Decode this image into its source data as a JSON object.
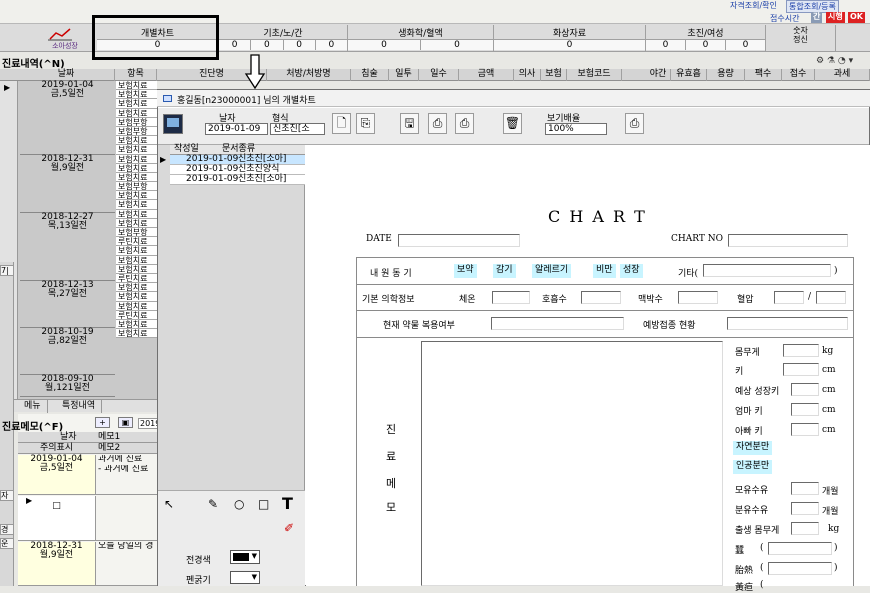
{
  "top_links": {
    "link1": "자격조회/확인",
    "link2": "통합조회/등록",
    "time_label": "접수시간",
    "tag_grey": "간",
    "tag_red": "시행",
    "tag_ok": "OK"
  },
  "tabs": [
    {
      "label": "개별차트",
      "values": [
        "0"
      ]
    },
    {
      "label": "기초/노/간",
      "values": [
        "0",
        "0",
        "0",
        "0"
      ]
    },
    {
      "label": "생화학/혈액",
      "values": [
        "0",
        "0"
      ]
    },
    {
      "label": "화상자료",
      "values": [
        "0"
      ]
    },
    {
      "label": "초진/여성",
      "values": [
        "0",
        "0",
        "0"
      ]
    },
    {
      "label": "숫자\n정신",
      "values": []
    }
  ],
  "logo_label": "소아성장",
  "records": {
    "title": "진료내역(^N)",
    "columns": [
      "날짜",
      "항목",
      "진단명",
      "처방/처방명",
      "침술",
      "일투",
      "일수",
      "금액",
      "의사",
      "보험",
      "보험코드",
      "야간",
      "유효흡",
      "용량",
      "팩수",
      "접수",
      "과세"
    ],
    "groups": [
      {
        "date": "2019-01-04",
        "day": "금,5일전",
        "items": [
          "보험치료",
          "보험치료",
          "보험치료",
          "보험치료",
          "보험부항",
          "보험부항"
        ]
      },
      {
        "date": "2018-12-31",
        "day": "월,9일전",
        "items": [
          "보험치료",
          "보험치료",
          "보험치료",
          "보험치료",
          "보험치료",
          "보험부항"
        ]
      },
      {
        "date": "2018-12-27",
        "day": "목,13일전",
        "items": [
          "보험치료",
          "보험치료",
          "보험치료",
          "보험치료",
          "보험부항",
          "루틴치료"
        ]
      },
      {
        "date": "2018-12-13",
        "day": "목,27일전",
        "items": [
          "보험치료",
          "보험치료",
          "보험치료",
          "루틴치료"
        ]
      },
      {
        "date": "2018-10-19",
        "day": "금,82일전",
        "items": [
          "보험치료",
          "보험치료",
          "보험치료",
          "루틴치료"
        ]
      },
      {
        "date": "2018-09-10",
        "day": "월,121일전",
        "items": [
          "보험치료",
          "보험치료"
        ]
      }
    ]
  },
  "side_tabs": [
    "메뉴",
    "특정내역"
  ],
  "memo": {
    "title": "진료메모(^F)",
    "header1": [
      "날자",
      "메모1"
    ],
    "header2": [
      "주의표시",
      "메모2"
    ],
    "rows": [
      {
        "date": "2019-01-04",
        "day": "금,5일전",
        "text1": "과거에 진료",
        "text2": "- 과거에 진료"
      },
      {
        "date": "□",
        "day": "",
        "text1": "",
        "text2": ""
      },
      {
        "date": "2018-12-31",
        "day": "월,9일전",
        "text1": "오늘 당일의 경",
        "text2": ""
      }
    ],
    "tag_2019": "2019"
  },
  "left_edge": [
    "7|",
    "자",
    "경",
    "운"
  ],
  "child": {
    "title": "홍길동[n23000001] 님의 개별차트",
    "toolbar": {
      "date_label": "날자",
      "date_value": "2019-01-09",
      "format_label": "형식",
      "format_value": "신초진[소",
      "zoom_label": "보기배율",
      "zoom_value": "100%"
    },
    "doclist": {
      "headers": [
        "작성일",
        "문서종류"
      ],
      "rows": [
        {
          "date": "2019-01-09",
          "type": "신초진[소아]",
          "selected": true
        },
        {
          "date": "2019-01-09",
          "type": "신초진양식",
          "selected": false
        },
        {
          "date": "2019-01-09",
          "type": "신초진[소아]",
          "selected": false
        }
      ]
    },
    "draw": {
      "fg_label": "전경색",
      "pen_label": "펜굵기"
    }
  },
  "chart_doc": {
    "heading": "C H A R T",
    "date_label": "DATE",
    "chartno_label": "CHART NO",
    "visit_label": "내 원 동 기",
    "visit_chips": [
      "보약",
      "감기",
      "알레르기",
      "비만",
      "성장"
    ],
    "other_label": "기타(",
    "close_paren": ")",
    "basic_label": "기본 의학정보",
    "temp_label": "체온",
    "resp_label": "호흡수",
    "pulse_label": "맥박수",
    "bp_label": "혈압",
    "slash": "/",
    "meds_label": "현재 약물 복용여부",
    "vacc_label": "예방접종 현황",
    "memo_label": [
      "진",
      "료",
      "메",
      "모"
    ],
    "weight_label": "몸무게",
    "kg": "kg",
    "height_label": "키",
    "cm": "cm",
    "pred_label": "예상 성장키",
    "mom_label": "엄마 키",
    "dad_label": "아빠 키",
    "natural": "자연분만",
    "artificial": "인공분만",
    "breast_label": "모유수유",
    "month": "개월",
    "formula_label": "분유수유",
    "birth_label": "출생 몸무게",
    "r1": "蠶",
    "r2": "胎熱",
    "r3": "黃疸",
    "paren_open": "(",
    "paren_close": ")"
  }
}
